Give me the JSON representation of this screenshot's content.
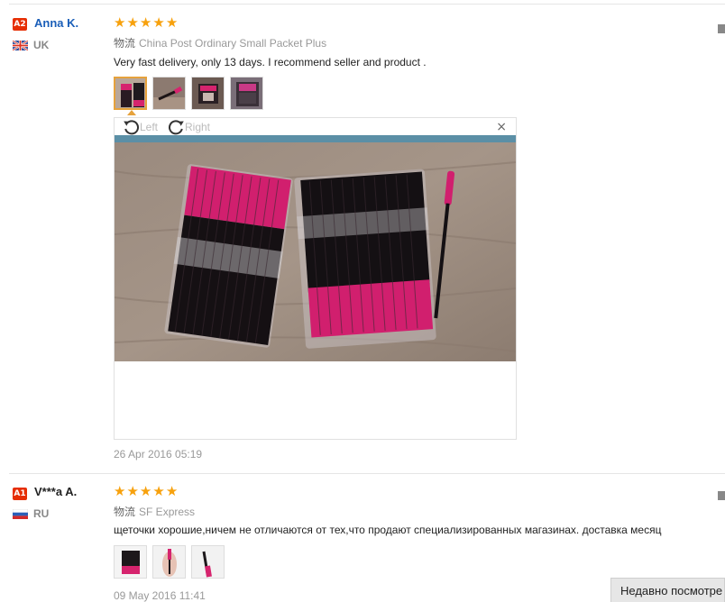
{
  "reviews": [
    {
      "badge": "A2",
      "name": "Anna K.",
      "country": "UK",
      "rating": 5,
      "shipping_label": "物流",
      "shipping": "China Post Ordinary Small Packet Plus",
      "comment": "Very fast delivery, only 13 days. I recommend seller and product .",
      "photo_count": 4,
      "date": "26 Apr 2016 05:19"
    },
    {
      "badge": "A1",
      "name": "V***a A.",
      "country": "RU",
      "rating": 5,
      "shipping_label": "物流",
      "shipping": "SF Express",
      "comment": "щеточки хорошие,ничем не отличаются от тех,что продают специализированных магазинах. доставка месяц",
      "photo_count": 3,
      "date": "09 May 2016 11:41"
    }
  ],
  "viewer": {
    "rotate_left": "Left",
    "rotate_right": "Right",
    "close": "×"
  },
  "star_glyph": "★",
  "recent_tab": "Недавно посмотре",
  "colors": {
    "accent_star": "#f7a10d",
    "badge": "#e62e04",
    "name_link": "#1a5eb8",
    "thumb_active": "#e6a23c"
  }
}
